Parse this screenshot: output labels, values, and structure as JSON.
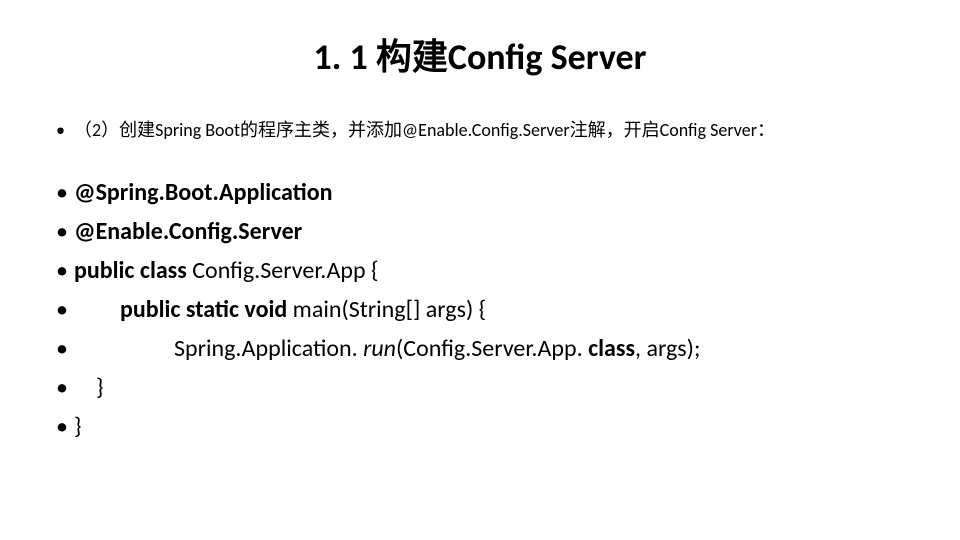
{
  "title": "1. 1 构建Config Server",
  "step": "（2）创建Spring Boot的程序主类，并添加@Enable.Config.Server注解，开启Config Server：",
  "code": {
    "l1": "@Spring.Boot.Application",
    "l2": "@Enable.Config.Server",
    "l3_pre": "public class",
    "l3_post": " Config.Server.App {",
    "l4_pre": "public static void",
    "l4_post": " main(String[] args) {",
    "l5_pre": "Spring.Application. ",
    "l5_italic": "run",
    "l5_post": "(Config.Server.App. ",
    "l5_bold2": "class",
    "l5_tail": ", args);",
    "l6": "}",
    "l7": "}"
  }
}
